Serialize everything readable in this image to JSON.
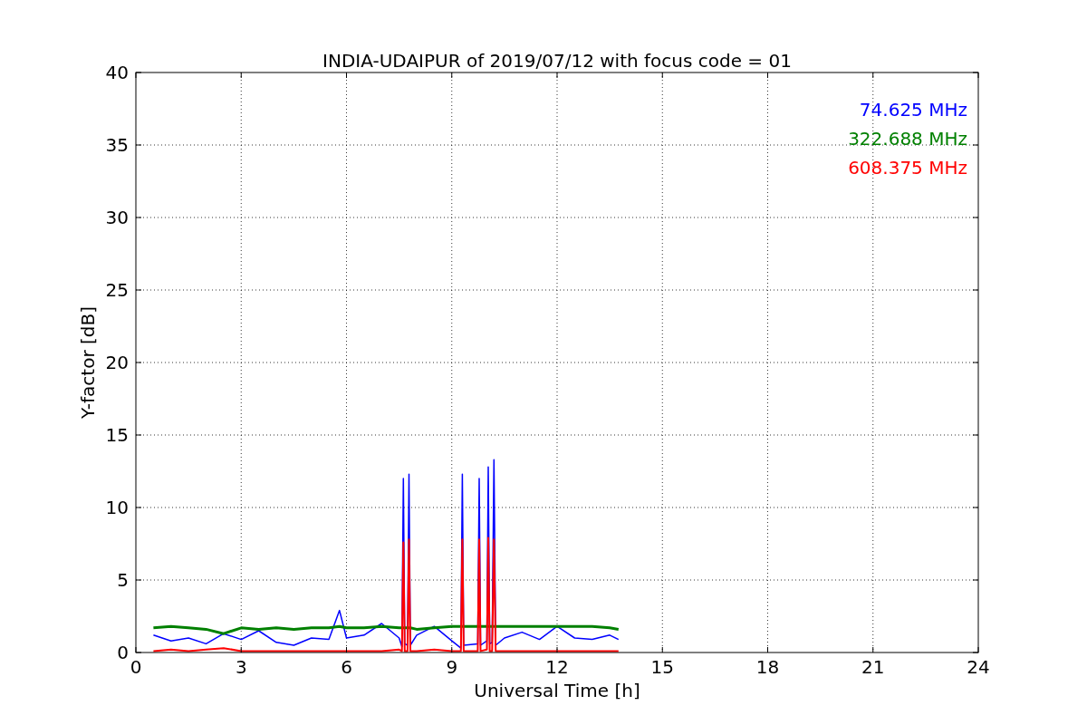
{
  "figure": {
    "chart_data": {
      "type": "line",
      "title": "INDIA-UDAIPUR of 2019/07/12 with focus code = 01",
      "xlabel": "Universal Time [h]",
      "ylabel": "Y-factor [dB]",
      "x": [
        0.5,
        1.0,
        1.5,
        2.0,
        2.5,
        3.0,
        3.5,
        4.0,
        4.5,
        5.0,
        5.5,
        5.8,
        6.0,
        6.5,
        7.0,
        7.5,
        7.58,
        7.62,
        7.66,
        7.74,
        7.78,
        7.82,
        8.0,
        8.5,
        9.0,
        9.26,
        9.3,
        9.34,
        9.74,
        9.78,
        9.82,
        10.0,
        10.04,
        10.08,
        10.15,
        10.2,
        10.25,
        10.5,
        11.0,
        11.5,
        12.0,
        12.5,
        13.0,
        13.5,
        13.75
      ],
      "series": [
        {
          "name": "74.625 MHz",
          "color": "#0000ff",
          "values": [
            1.2,
            0.8,
            1.0,
            0.6,
            1.3,
            0.9,
            1.5,
            0.7,
            0.5,
            1.0,
            0.9,
            2.9,
            1.0,
            1.2,
            2.0,
            1.0,
            0.4,
            12.0,
            0.6,
            0.5,
            12.3,
            0.5,
            1.2,
            1.8,
            0.8,
            0.3,
            12.3,
            0.5,
            0.6,
            12.0,
            0.5,
            0.8,
            12.8,
            0.6,
            0.7,
            13.3,
            0.5,
            1.0,
            1.4,
            0.9,
            1.8,
            1.0,
            0.9,
            1.2,
            0.9
          ]
        },
        {
          "name": "322.688 MHz",
          "color": "#008000",
          "values": [
            1.7,
            1.8,
            1.7,
            1.6,
            1.3,
            1.7,
            1.6,
            1.7,
            1.6,
            1.7,
            1.7,
            1.8,
            1.7,
            1.7,
            1.8,
            1.7,
            1.7,
            1.7,
            1.7,
            1.7,
            1.7,
            1.7,
            1.6,
            1.7,
            1.8,
            1.8,
            1.8,
            1.8,
            1.8,
            1.8,
            1.8,
            1.8,
            1.8,
            1.8,
            1.8,
            1.8,
            1.8,
            1.8,
            1.8,
            1.8,
            1.8,
            1.8,
            1.8,
            1.7,
            1.6
          ]
        },
        {
          "name": "608.375 MHz",
          "color": "#ff0000",
          "values": [
            0.1,
            0.2,
            0.1,
            0.2,
            0.3,
            0.1,
            0.1,
            0.1,
            0.1,
            0.1,
            0.1,
            0.1,
            0.1,
            0.1,
            0.1,
            0.2,
            0.1,
            7.6,
            0.1,
            0.1,
            7.8,
            0.1,
            0.1,
            0.2,
            0.1,
            0.1,
            7.8,
            0.1,
            0.1,
            7.8,
            0.1,
            0.2,
            7.9,
            0.1,
            0.1,
            7.8,
            0.1,
            0.1,
            0.1,
            0.1,
            0.1,
            0.1,
            0.1,
            0.1,
            0.1
          ]
        }
      ],
      "xlim": [
        0,
        24
      ],
      "ylim": [
        0,
        40
      ],
      "xticks": [
        0,
        3,
        6,
        9,
        12,
        15,
        18,
        21,
        24
      ],
      "yticks": [
        0,
        5,
        10,
        15,
        20,
        25,
        30,
        35,
        40
      ],
      "grid": true
    }
  }
}
